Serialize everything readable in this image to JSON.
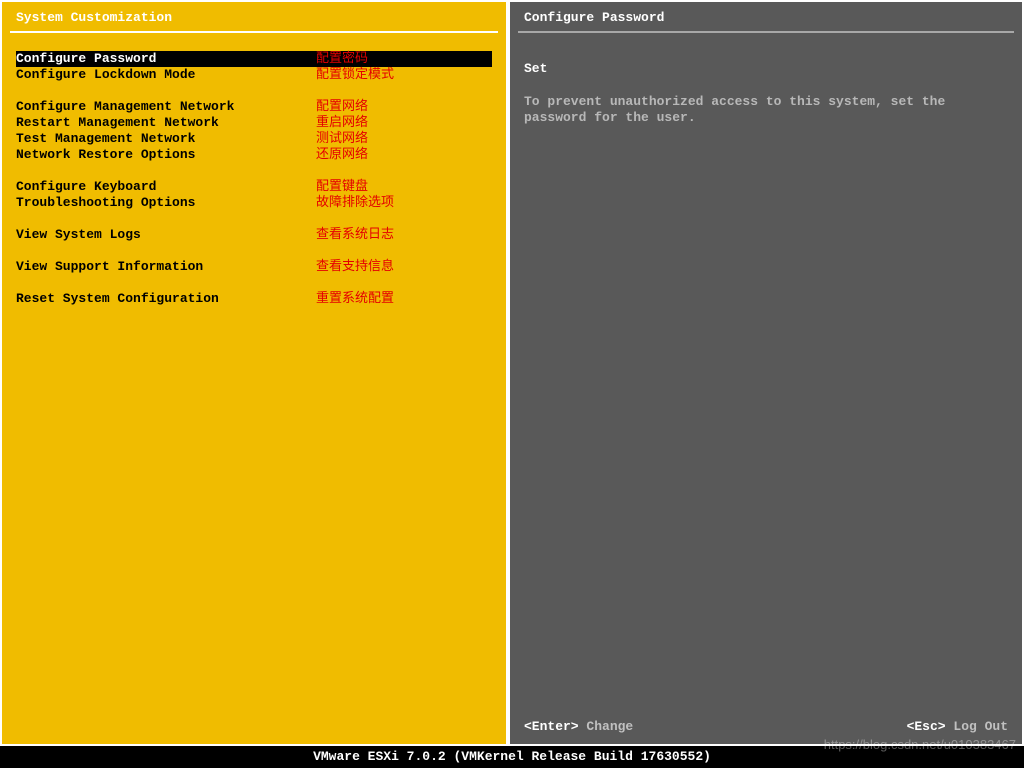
{
  "left": {
    "title": "System Customization",
    "groups": [
      [
        {
          "label": "Configure Password",
          "anno": "配置密码",
          "selected": true
        },
        {
          "label": "Configure Lockdown Mode",
          "anno": "配置锁定模式"
        }
      ],
      [
        {
          "label": "Configure Management Network",
          "anno": "配置网络"
        },
        {
          "label": "Restart Management Network",
          "anno": "重启网络"
        },
        {
          "label": "Test Management Network",
          "anno": "测试网络"
        },
        {
          "label": "Network Restore Options",
          "anno": "还原网络"
        }
      ],
      [
        {
          "label": "Configure Keyboard",
          "anno": "配置键盘"
        },
        {
          "label": "Troubleshooting Options",
          "anno": "故障排除选项"
        }
      ],
      [
        {
          "label": "View System Logs",
          "anno": "查看系统日志"
        }
      ],
      [
        {
          "label": "View Support Information",
          "anno": "查看支持信息"
        }
      ],
      [
        {
          "label": "Reset System Configuration",
          "anno": "重置系统配置"
        }
      ]
    ]
  },
  "right": {
    "title": "Configure Password",
    "heading": "Set",
    "body": "To prevent unauthorized access to this system, set the password for the user."
  },
  "keybar": {
    "enter_key": "<Enter>",
    "enter_label": "Change",
    "esc_key": "<Esc>",
    "esc_label": "Log Out"
  },
  "statusbar": "VMware ESXi 7.0.2 (VMKernel Release Build 17630552)",
  "watermark": "https://blog.csdn.net/u010383467"
}
